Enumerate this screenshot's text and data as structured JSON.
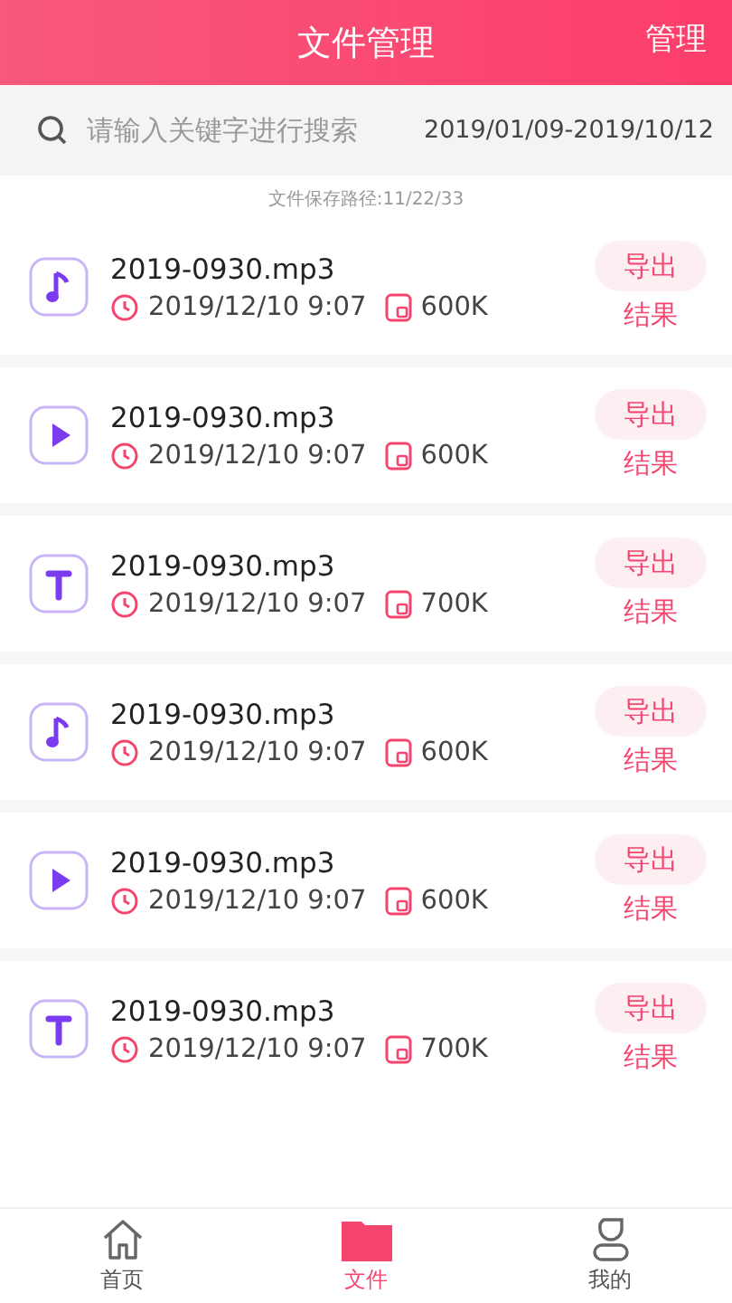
{
  "header": {
    "title": "文件管理",
    "action": "管理"
  },
  "search": {
    "placeholder": "请输入关键字进行搜索",
    "date_range": "2019/01/09-2019/10/12"
  },
  "save_path": "文件保存路径:11/22/33",
  "files": [
    {
      "kind": "audio",
      "name": "2019-0930.mp3",
      "time": "2019/12/10 9:07",
      "size": "600K",
      "export": "导出",
      "result": "结果"
    },
    {
      "kind": "video",
      "name": "2019-0930.mp3",
      "time": "2019/12/10 9:07",
      "size": "600K",
      "export": "导出",
      "result": "结果"
    },
    {
      "kind": "text",
      "name": "2019-0930.mp3",
      "time": "2019/12/10 9:07",
      "size": "700K",
      "export": "导出",
      "result": "结果"
    },
    {
      "kind": "audio",
      "name": "2019-0930.mp3",
      "time": "2019/12/10 9:07",
      "size": "600K",
      "export": "导出",
      "result": "结果"
    },
    {
      "kind": "video",
      "name": "2019-0930.mp3",
      "time": "2019/12/10 9:07",
      "size": "600K",
      "export": "导出",
      "result": "结果"
    },
    {
      "kind": "text",
      "name": "2019-0930.mp3",
      "time": "2019/12/10 9:07",
      "size": "700K",
      "export": "导出",
      "result": "结果"
    }
  ],
  "tabs": [
    {
      "kind": "home",
      "label": "首页",
      "selected": false
    },
    {
      "kind": "files",
      "label": "文件",
      "selected": true
    },
    {
      "kind": "profile",
      "label": "我的",
      "selected": false
    }
  ]
}
